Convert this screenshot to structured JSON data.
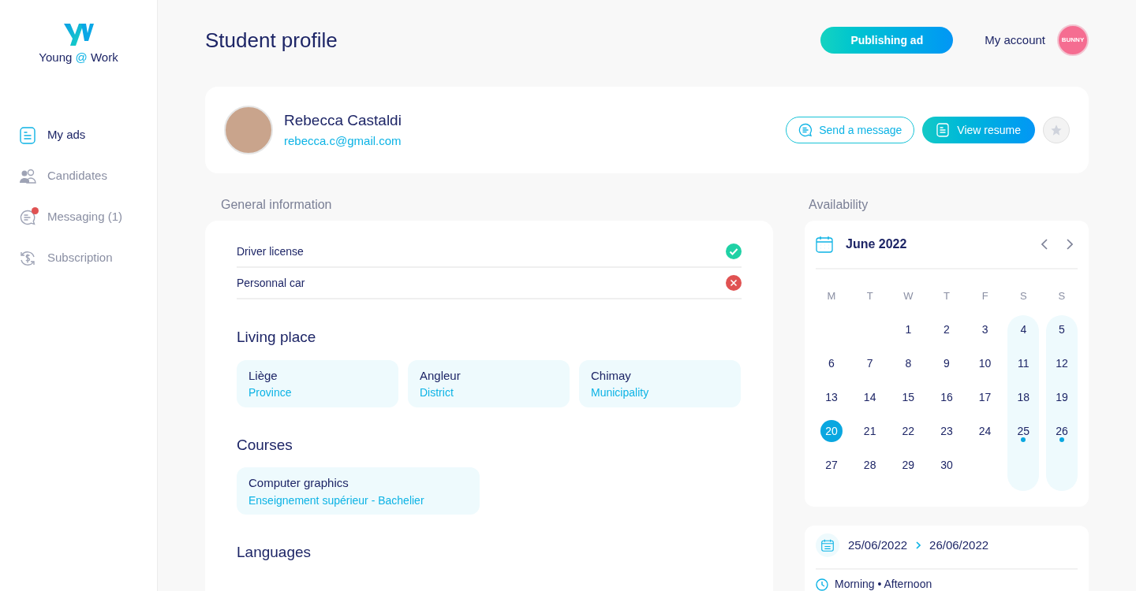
{
  "brand": {
    "name": "Young",
    "at": "@",
    "suffix": "Work"
  },
  "sidebar": {
    "items": [
      {
        "label": "My ads",
        "kind": "document",
        "selected": true,
        "notification": false
      },
      {
        "label": "Candidates",
        "kind": "people",
        "selected": false,
        "notification": false
      },
      {
        "label": "Messaging (1)",
        "kind": "chat",
        "selected": false,
        "notification": true
      },
      {
        "label": "Subscription",
        "kind": "renew",
        "selected": false,
        "notification": false
      }
    ]
  },
  "header": {
    "title": "Student profile",
    "publish_button": "Publishing ad",
    "account_link": "My account",
    "account_avatar": "BUNNY"
  },
  "profile": {
    "name": "Rebecca Castaldi",
    "email": "rebecca.c@gmail.com",
    "message_button": "Send a message",
    "resume_button": "View resume",
    "favorite": false
  },
  "general_information": {
    "title": "General information",
    "checks": [
      {
        "label": "Driver license",
        "value": true
      },
      {
        "label": "Personnal car",
        "value": false
      }
    ],
    "sections": [
      {
        "title": "Living place",
        "cards": [
          {
            "title": "Liège",
            "subtitle": "Province"
          },
          {
            "title": "Angleur",
            "subtitle": "District"
          },
          {
            "title": "Chimay",
            "subtitle": "Municipality"
          }
        ]
      },
      {
        "title": "Courses",
        "cards": [
          {
            "title": "Computer graphics",
            "subtitle": "Enseignement supérieur - Bachelier"
          }
        ]
      },
      {
        "title": "Languages"
      }
    ]
  },
  "availability": {
    "title": "Availability",
    "month": "June 2022",
    "weekdays": [
      {
        "label": "M",
        "highlighted": false
      },
      {
        "label": "T",
        "highlighted": false
      },
      {
        "label": "W",
        "highlighted": false
      },
      {
        "label": "T",
        "highlighted": false
      },
      {
        "label": "F",
        "highlighted": false
      },
      {
        "label": "S",
        "highlighted": true
      },
      {
        "label": "S",
        "highlighted": true
      }
    ],
    "weeks": [
      [
        {
          "day": "1",
          "selected": false,
          "marked": false
        },
        {
          "day": "2",
          "selected": false,
          "marked": false
        },
        {
          "day": "3",
          "selected": false,
          "marked": false
        },
        {
          "day": "4",
          "selected": false,
          "marked": false
        },
        {
          "day": "5",
          "selected": false,
          "marked": false
        }
      ],
      [
        {
          "day": "6",
          "selected": false,
          "marked": false
        },
        {
          "day": "7",
          "selected": false,
          "marked": false
        },
        {
          "day": "8",
          "selected": false,
          "marked": false
        },
        {
          "day": "9",
          "selected": false,
          "marked": false
        },
        {
          "day": "10",
          "selected": false,
          "marked": false
        },
        {
          "day": "11",
          "selected": false,
          "marked": false
        },
        {
          "day": "12",
          "selected": false,
          "marked": false
        }
      ],
      [
        {
          "day": "13",
          "selected": false,
          "marked": false
        },
        {
          "day": "14",
          "selected": false,
          "marked": false
        },
        {
          "day": "15",
          "selected": false,
          "marked": false
        },
        {
          "day": "16",
          "selected": false,
          "marked": false
        },
        {
          "day": "17",
          "selected": false,
          "marked": false
        },
        {
          "day": "18",
          "selected": false,
          "marked": false
        },
        {
          "day": "19",
          "selected": false,
          "marked": false
        }
      ],
      [
        {
          "day": "20",
          "selected": true,
          "marked": false
        },
        {
          "day": "21",
          "selected": false,
          "marked": false
        },
        {
          "day": "22",
          "selected": false,
          "marked": false
        },
        {
          "day": "23",
          "selected": false,
          "marked": false
        },
        {
          "day": "24",
          "selected": false,
          "marked": false
        },
        {
          "day": "25",
          "selected": false,
          "marked": true
        },
        {
          "day": "26",
          "selected": false,
          "marked": true
        }
      ],
      [
        {
          "day": "27",
          "selected": false,
          "marked": false
        },
        {
          "day": "28",
          "selected": false,
          "marked": false
        },
        {
          "day": "29",
          "selected": false,
          "marked": false
        },
        {
          "day": "30",
          "selected": false,
          "marked": false
        }
      ]
    ],
    "range": {
      "start": "25/06/2022",
      "end": "26/06/2022",
      "times": "Morning • Afternoon"
    }
  }
}
